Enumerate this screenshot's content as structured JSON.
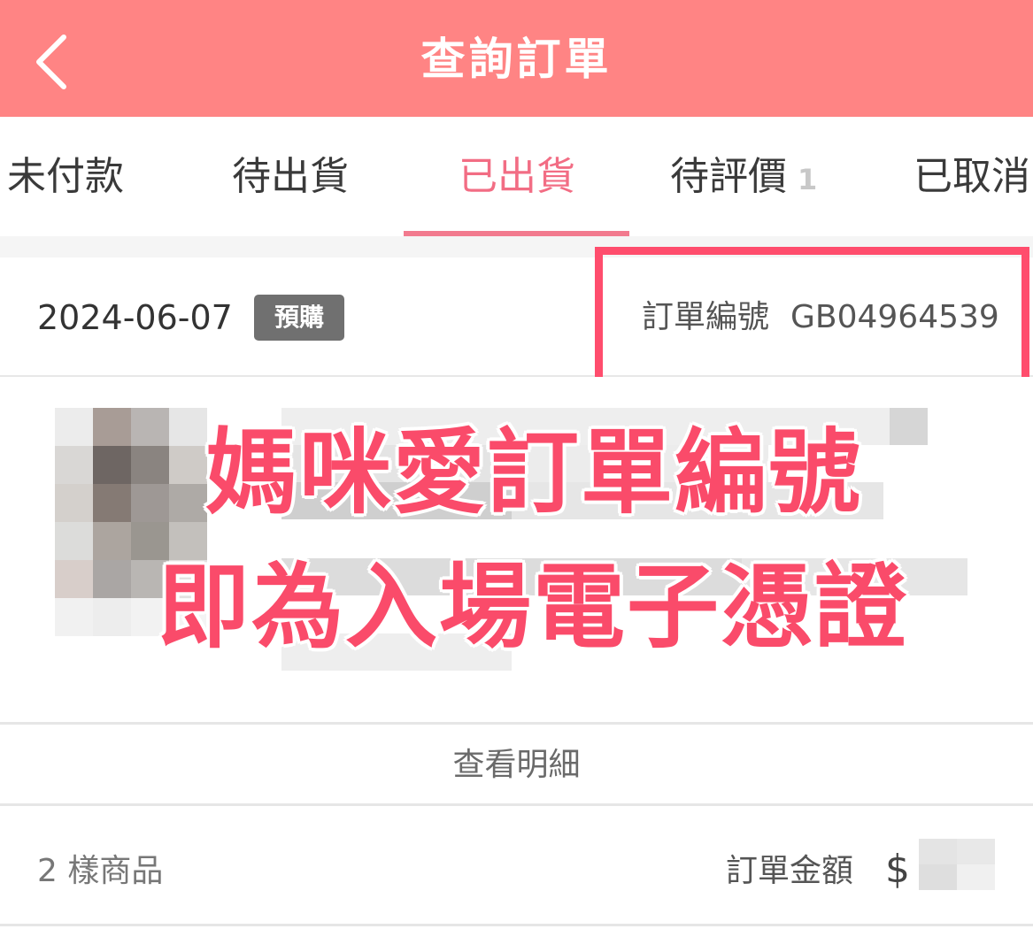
{
  "header": {
    "title": "查詢訂單",
    "back_icon": "chevron-left-icon",
    "background_color": "#ff8484"
  },
  "tabs": [
    {
      "label": "未付款",
      "active": false
    },
    {
      "label": "待出貨",
      "active": false
    },
    {
      "label": "已出貨",
      "active": true
    },
    {
      "label": "待評價",
      "badge": "1",
      "active": false
    },
    {
      "label": "已取消",
      "active": false
    }
  ],
  "order": {
    "date": "2024-06-07",
    "badge": "預購",
    "number_label": "訂單編號",
    "number_value": "GB04964539",
    "highlight_color": "#ff4d6d"
  },
  "overlay": {
    "line1": "媽咪愛訂單編號",
    "line2": "即為入場電子憑證",
    "color": "#fa4b6a"
  },
  "detail": {
    "link_label": "查看明細"
  },
  "summary": {
    "item_count": "2 樣商品",
    "amount_label": "訂單金額",
    "currency": "$"
  }
}
